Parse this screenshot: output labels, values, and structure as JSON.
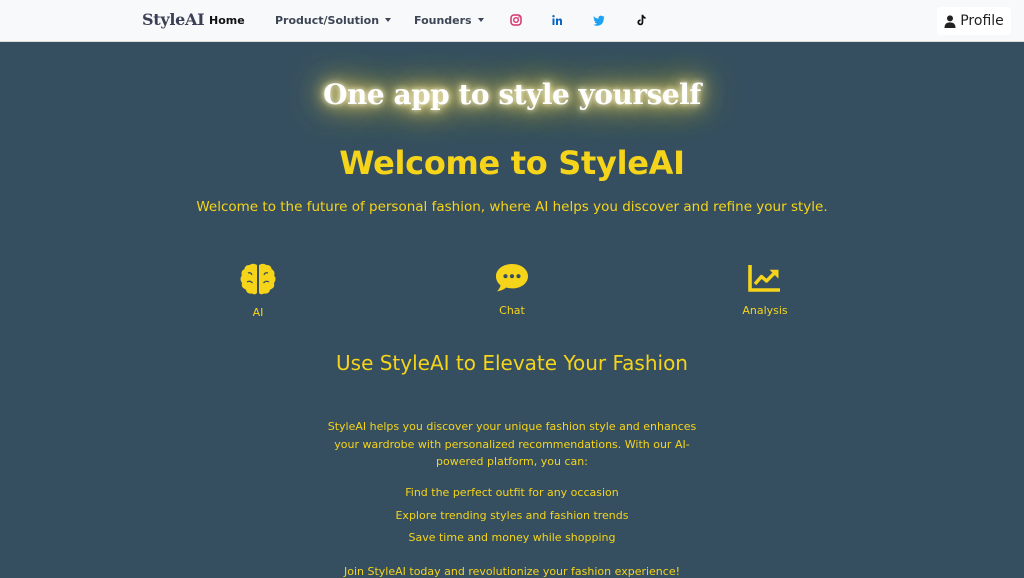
{
  "nav": {
    "brand": "StyleAI",
    "home": "Home",
    "product": "Product/Solution",
    "founders": "Founders",
    "social_icons": [
      "instagram-icon",
      "linkedin-icon",
      "twitter-icon",
      "tiktok-icon"
    ],
    "profile": "Profile"
  },
  "hero": {
    "tagline": "One app to style yourself",
    "title": "Welcome to StyleAI",
    "subtitle": "Welcome to the future of personal fashion, where AI helps you discover and refine your style."
  },
  "features": [
    {
      "icon": "brain-icon",
      "label": "AI"
    },
    {
      "icon": "chat-icon",
      "label": "Chat"
    },
    {
      "icon": "chart-line-icon",
      "label": "Analysis"
    }
  ],
  "section": {
    "title": "Use StyleAI to Elevate Your Fashion",
    "body": "StyleAI helps you discover your unique fashion style and enhances your wardrobe with personalized recommendations. With our AI-powered platform, you can:",
    "benefits": [
      "Find the perfect outfit for any occasion",
      "Explore trending styles and fashion trends",
      "Save time and money while shopping"
    ],
    "cta": "Join StyleAI today and revolutionize your fashion experience!"
  },
  "colors": {
    "background": "#354f60",
    "accent": "#f5d41a",
    "navbar": "#f8f9fa"
  }
}
